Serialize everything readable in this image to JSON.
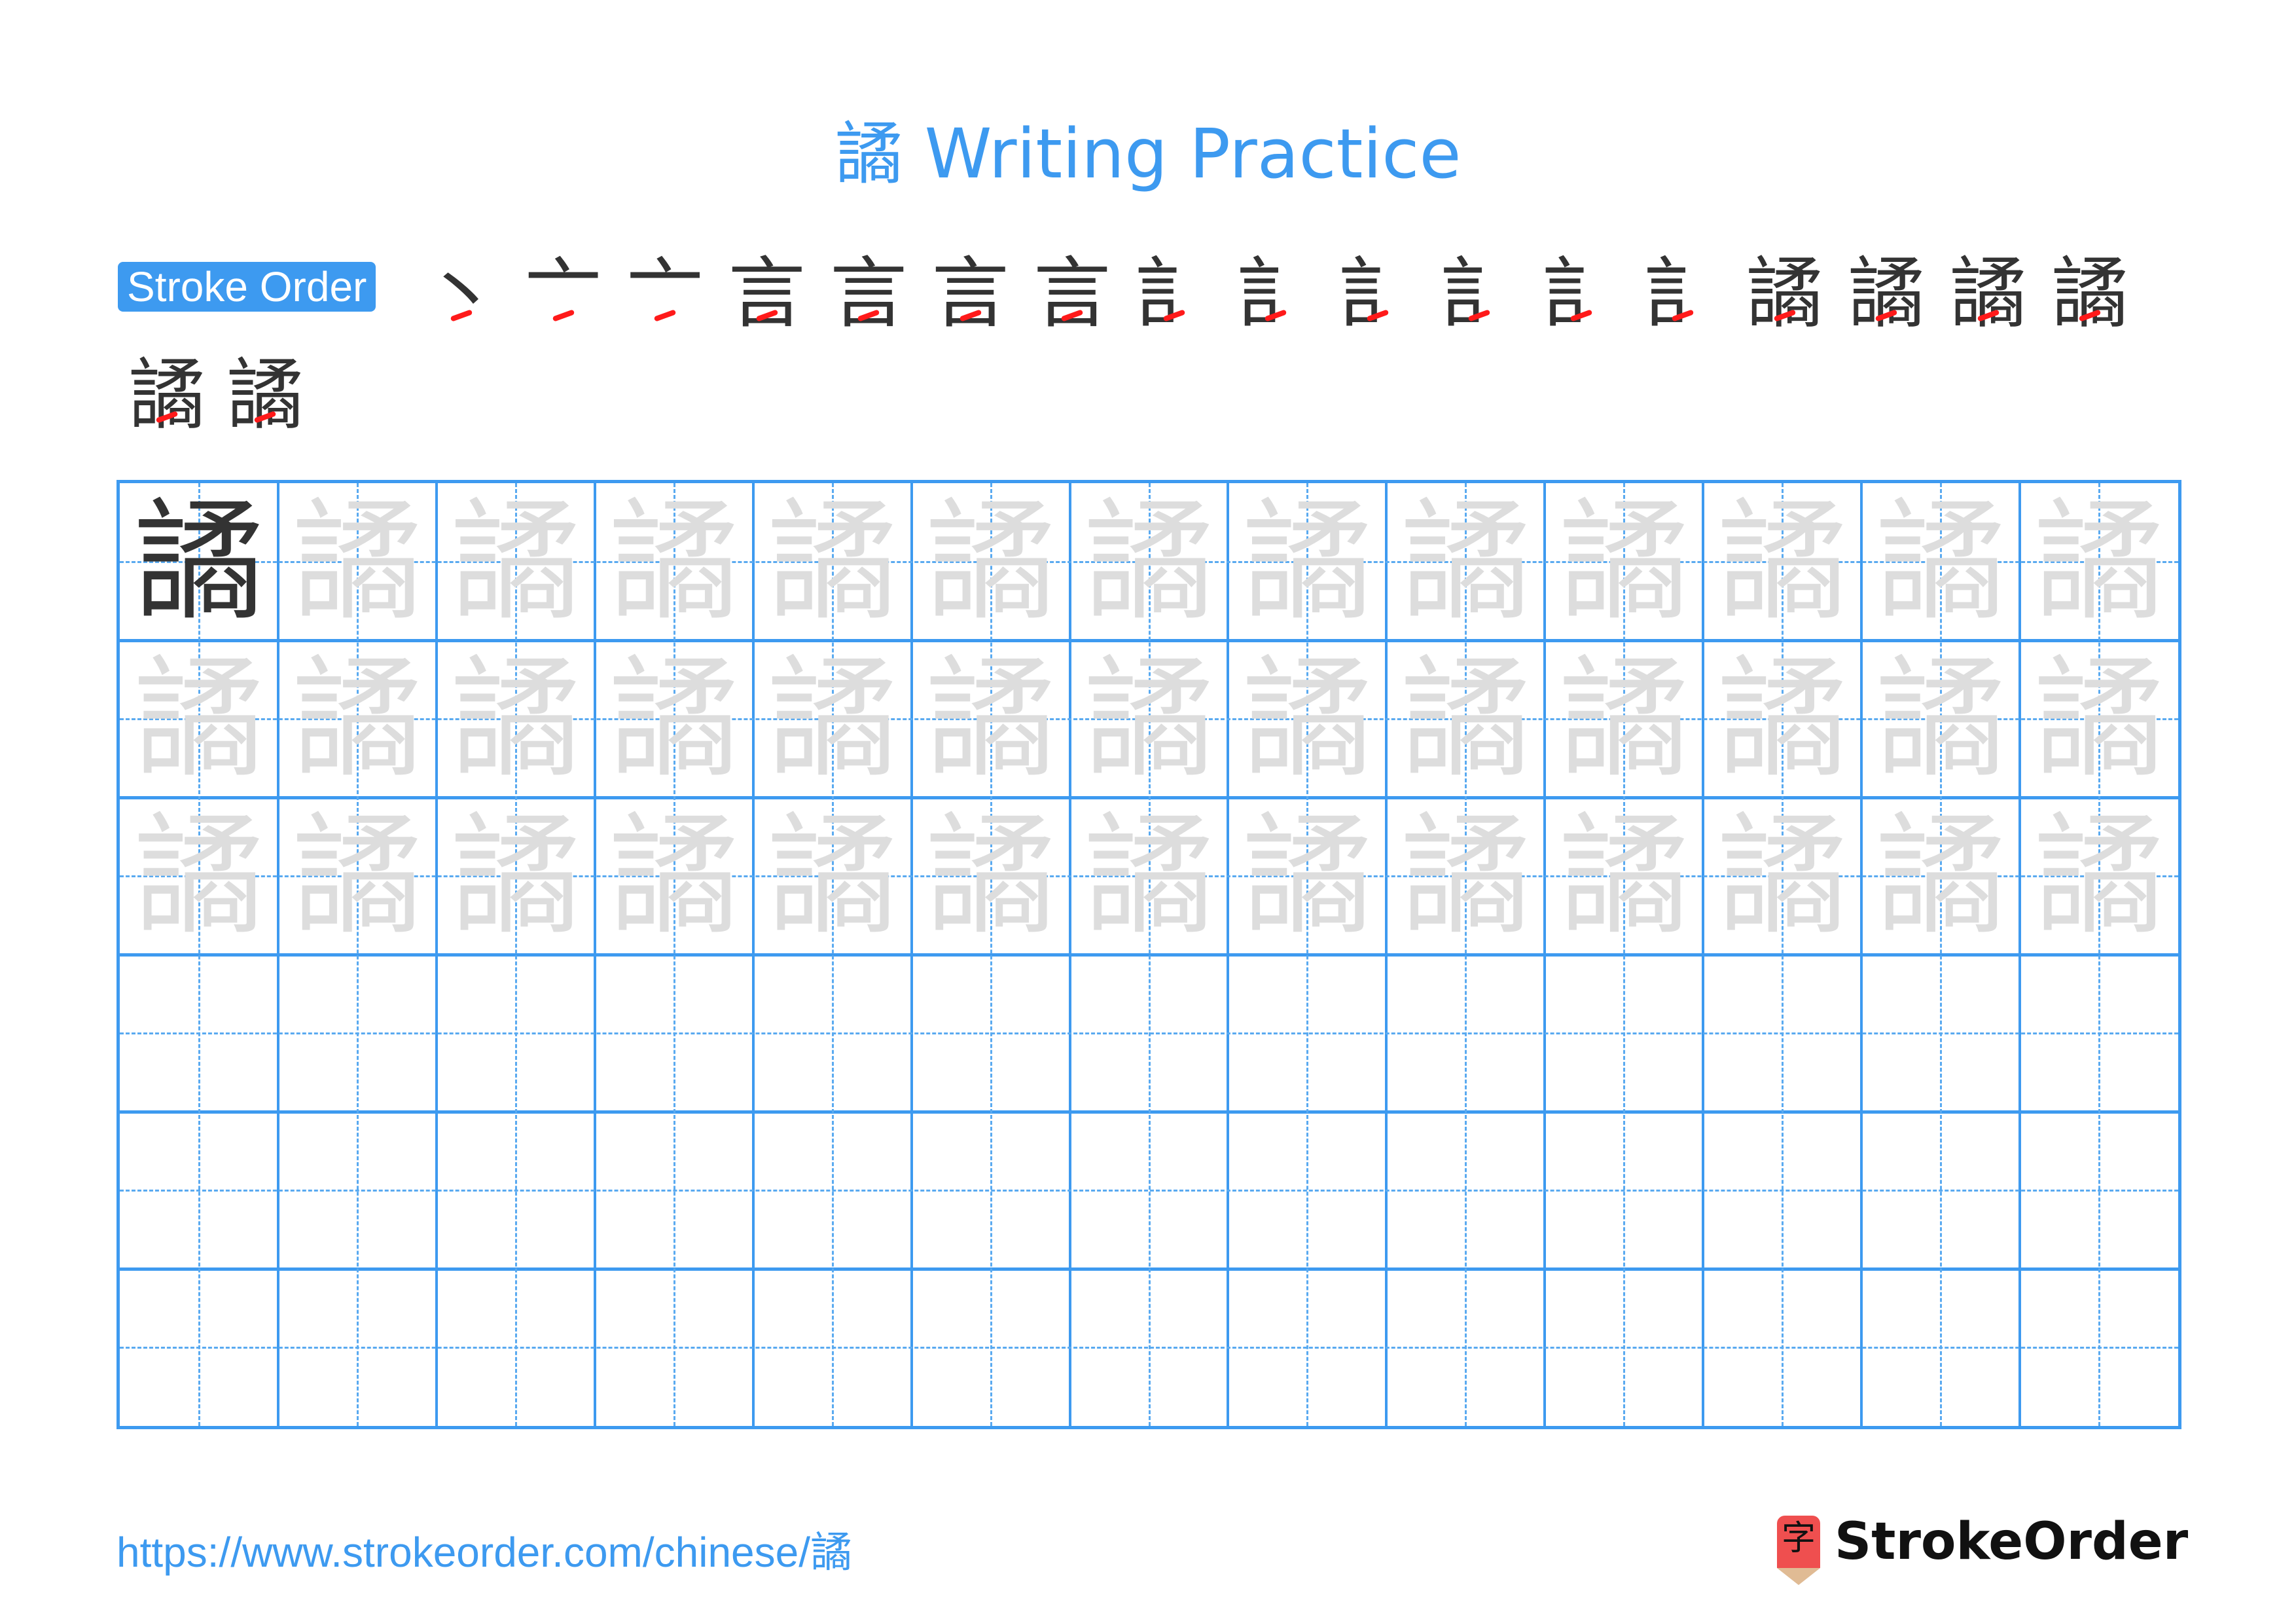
{
  "page": {
    "character": "譎",
    "title_suffix": "Writing Practice",
    "title": "譎 Writing Practice"
  },
  "stroke_order": {
    "label": "Stroke Order",
    "stroke_count": 19,
    "steps": [
      {
        "step": 1,
        "glyph": "丶"
      },
      {
        "step": 2,
        "glyph": "亠"
      },
      {
        "step": 3,
        "glyph": "亠"
      },
      {
        "step": 4,
        "glyph": "言"
      },
      {
        "step": 5,
        "glyph": "言"
      },
      {
        "step": 6,
        "glyph": "言"
      },
      {
        "step": 7,
        "glyph": "言"
      },
      {
        "step": 8,
        "glyph": "訁"
      },
      {
        "step": 9,
        "glyph": "訁"
      },
      {
        "step": 10,
        "glyph": "訁"
      },
      {
        "step": 11,
        "glyph": "訁"
      },
      {
        "step": 12,
        "glyph": "訁"
      },
      {
        "step": 13,
        "glyph": "訁"
      },
      {
        "step": 14,
        "glyph": "譎"
      },
      {
        "step": 15,
        "glyph": "譎"
      },
      {
        "step": 16,
        "glyph": "譎"
      },
      {
        "step": 17,
        "glyph": "譎"
      },
      {
        "step": 18,
        "glyph": "譎"
      },
      {
        "step": 19,
        "glyph": "譎"
      }
    ],
    "highlight_color": "#ff1a1a",
    "ink_color": "#333333"
  },
  "practice_grid": {
    "columns": 13,
    "rows": 6,
    "model_character": "譎",
    "trace_rows": 3,
    "empty_rows": 3,
    "grid_color": "#3d9af0",
    "trace_color": "#dddddd"
  },
  "footer": {
    "url": "https://www.strokeorder.com/chinese/譎",
    "logo_glyph": "字",
    "logo_text": "StrokeOrder"
  },
  "colors": {
    "accent": "#3d9af0",
    "logo_red": "#ef4f4f",
    "logo_tan": "#e0bb94"
  }
}
